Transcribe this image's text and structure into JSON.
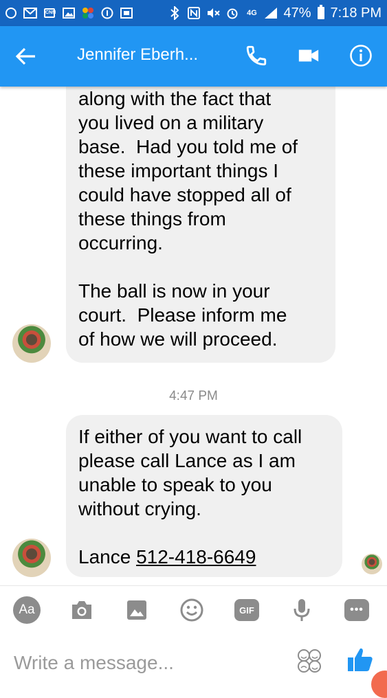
{
  "status_bar": {
    "network": "4G",
    "battery": "47%",
    "time": "7:18 PM",
    "notification_icons": [
      "circle-icon",
      "gmail-icon",
      "cnn-icon",
      "image-icon",
      "pinwheel-icon",
      "vpn-icon",
      "photo-icon"
    ],
    "system_icons": [
      "bluetooth-icon",
      "nfc-icon",
      "mute-icon",
      "alarm-icon",
      "lte-icon",
      "signal-icon",
      "battery-icon"
    ]
  },
  "header": {
    "contact_name": "Jennifer Eberh...",
    "icons": [
      "back-arrow-icon",
      "phone-icon",
      "video-camera-icon",
      "info-icon"
    ],
    "color": "#2196f3"
  },
  "messages": [
    {
      "text": "along with the fact that\nyou lived on a military\nbase.  Had you told me of\nthese important things I\ncould have stopped all of\nthese things from\noccurring.\n\nThe ball is now in your\ncourt.  Please inform me\nof how we will proceed."
    },
    {
      "timestamp": "4:47 PM",
      "text": "If either of you want to call\nplease call Lance as I am\nunable to speak to you\nwithout crying.",
      "signature": "Lance",
      "phone": "512-418-6649"
    }
  ],
  "composer": {
    "placeholder": "Write a message...",
    "aa_label": "Aa",
    "gif_label": "GIF",
    "tool_icons": [
      "text-format-icon",
      "camera-icon",
      "gallery-icon",
      "emoji-icon",
      "gif-icon",
      "microphone-icon",
      "more-icon"
    ],
    "right_icons": [
      "stickers-icon",
      "thumbs-up-icon"
    ],
    "like_color": "#2196f3"
  }
}
